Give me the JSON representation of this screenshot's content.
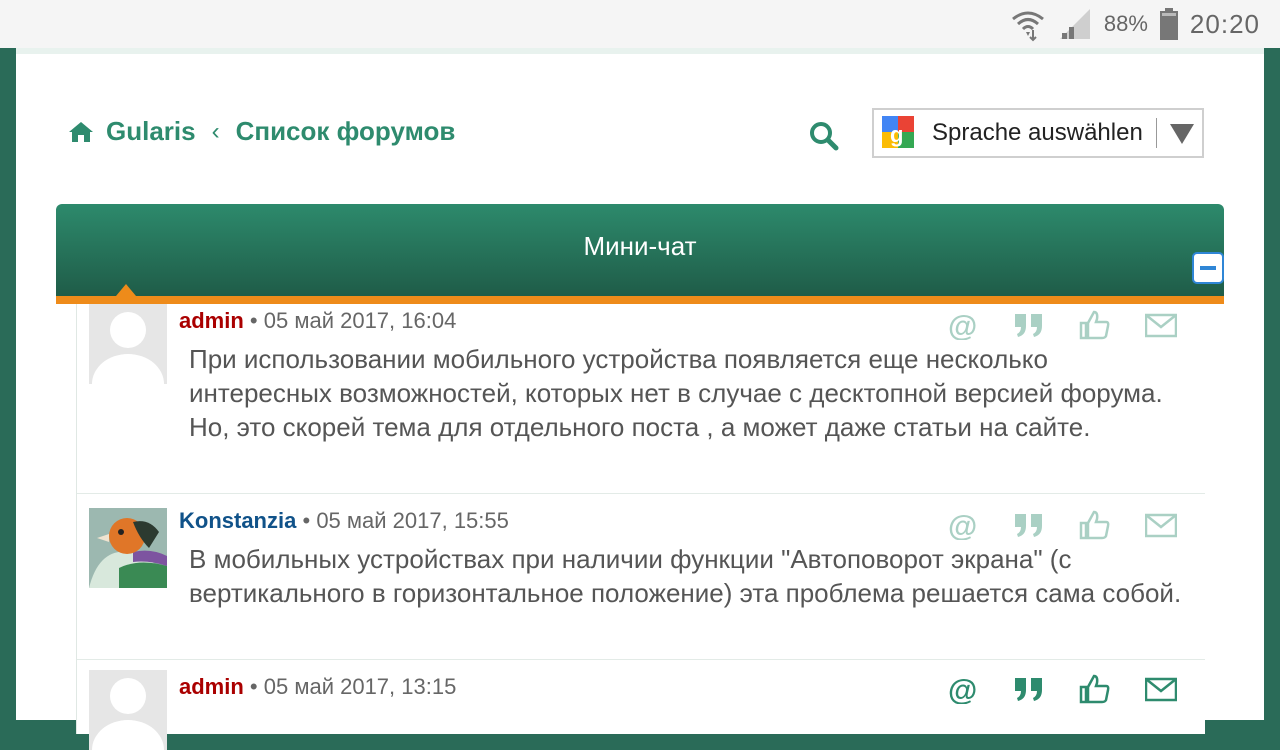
{
  "status_bar": {
    "battery_percent": "88%",
    "time": "20:20"
  },
  "header": {
    "breadcrumb_home": "Gularis",
    "breadcrumb_separator": "‹",
    "breadcrumb_current": "Список форумов",
    "language_select_value": "Sprache auswählen"
  },
  "chat": {
    "title": "Мини-чат",
    "messages": [
      {
        "author": "admin",
        "role": "admin",
        "separator": "•",
        "date": "05 май 2017, 16:04",
        "text": "При использовании мобильного устройства появляется еще несколько интересных возможностей, которых нет в случае с десктопной версией форума. Но, это скорей тема для отдельного поста , а может даже статьи на сайте."
      },
      {
        "author": "Konstanzia",
        "role": "user",
        "separator": "•",
        "date": "05 май 2017, 15:55",
        "text": "В мобильных устройствах при наличии функции \"Автоповорот экрана\" (с вертикального в горизонтальное положение) эта проблема решается сама собой."
      },
      {
        "author": "admin",
        "role": "admin",
        "separator": "•",
        "date": "05 май 2017, 13:15",
        "text": ""
      }
    ]
  },
  "colors": {
    "brand_green": "#2e8b6e",
    "header_orange": "#ee8b1a",
    "admin_red": "#aa0000",
    "user_blue": "#105289"
  },
  "icons": [
    "wifi-icon",
    "signal-icon",
    "battery-icon",
    "home-icon",
    "search-icon",
    "google-translate-icon",
    "dropdown-arrow-icon",
    "collapse-icon",
    "mention-icon",
    "quote-icon",
    "like-icon",
    "message-icon"
  ]
}
